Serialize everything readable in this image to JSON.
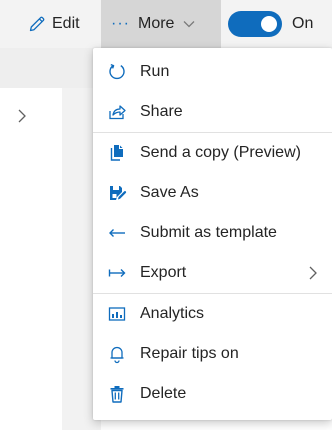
{
  "toolbar": {
    "edit_label": "Edit",
    "more_label": "More",
    "toggle_label": "On",
    "toggle_on": true
  },
  "menu": {
    "items": [
      {
        "label": "Run",
        "icon": "run-icon"
      },
      {
        "label": "Share",
        "icon": "share-icon"
      },
      {
        "label": "Send a copy (Preview)",
        "icon": "copy-icon"
      },
      {
        "label": "Save As",
        "icon": "save-as-icon"
      },
      {
        "label": "Submit as template",
        "icon": "submit-arrow-icon"
      },
      {
        "label": "Export",
        "icon": "export-arrow-icon",
        "has_submenu": true
      },
      {
        "label": "Analytics",
        "icon": "analytics-icon"
      },
      {
        "label": "Repair tips on",
        "icon": "bell-icon"
      },
      {
        "label": "Delete",
        "icon": "trash-icon"
      }
    ]
  },
  "colors": {
    "accent": "#0f6cbd",
    "toolbar_bg": "#f3f3f3",
    "more_active_bg": "#d6d6d6",
    "text": "#242424",
    "separator": "#e1e1e1"
  }
}
